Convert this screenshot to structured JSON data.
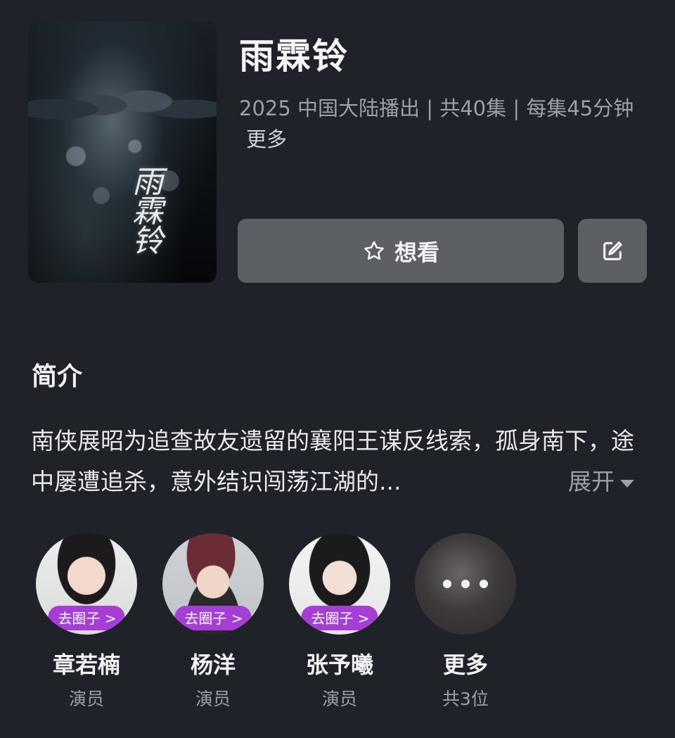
{
  "show": {
    "title": "雨霖铃",
    "poster_text": "雨霖铃",
    "meta": "2025 中国大陆播出 | 共40集 | 每集45分钟",
    "more_label": "更多"
  },
  "actions": {
    "want_label": "想看",
    "want_icon": "star-icon",
    "edit_icon": "edit-icon"
  },
  "synopsis": {
    "title": "简介",
    "text": "南侠展昭为追查故友遗留的襄阳王谋反线索，孤身南下，途中屡遭追杀，意外结识闯荡江湖的...",
    "expand_label": "展开"
  },
  "cast": [
    {
      "name": "章若楠",
      "role": "演员",
      "badge": "去圈子 >"
    },
    {
      "name": "杨洋",
      "role": "演员",
      "badge": "去圈子 >"
    },
    {
      "name": "张予曦",
      "role": "演员",
      "badge": "去圈子 >"
    },
    {
      "name": "更多",
      "role": "共3位",
      "badge": ""
    }
  ],
  "colors": {
    "background": "#1f2329",
    "button": "#5c5f64",
    "badge": "#a63ed6",
    "muted_text": "#9aa0a6"
  }
}
